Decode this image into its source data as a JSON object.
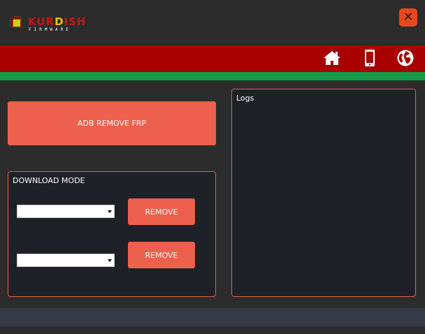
{
  "window": {
    "logo_text_main_a": "KUR",
    "logo_text_main_b": "D",
    "logo_text_main_c": "ISH",
    "logo_subtitle": "FIRMWARE",
    "close_icon": "close-icon"
  },
  "nav": {
    "icons": [
      "home-icon",
      "phone-icon",
      "globe-icon"
    ]
  },
  "main": {
    "frp_button_label": "ADB REMOVE FRP",
    "download_panel_title": "DOWNLOAD MODE",
    "select_1_value": "",
    "select_2_value": "",
    "remove_button_1_label": "REMOVE",
    "remove_button_2_label": "REMOVE"
  },
  "logs": {
    "title": "Logs",
    "content": ""
  },
  "colors": {
    "background": "#2c2c2c",
    "red_bar": "#a80000",
    "green_bar": "#169a4a",
    "accent_button": "#ec604d",
    "panel_border": "#e95f48",
    "panel_bg": "#1f2128",
    "close_button": "#e6491e",
    "footer": "#363a45"
  }
}
